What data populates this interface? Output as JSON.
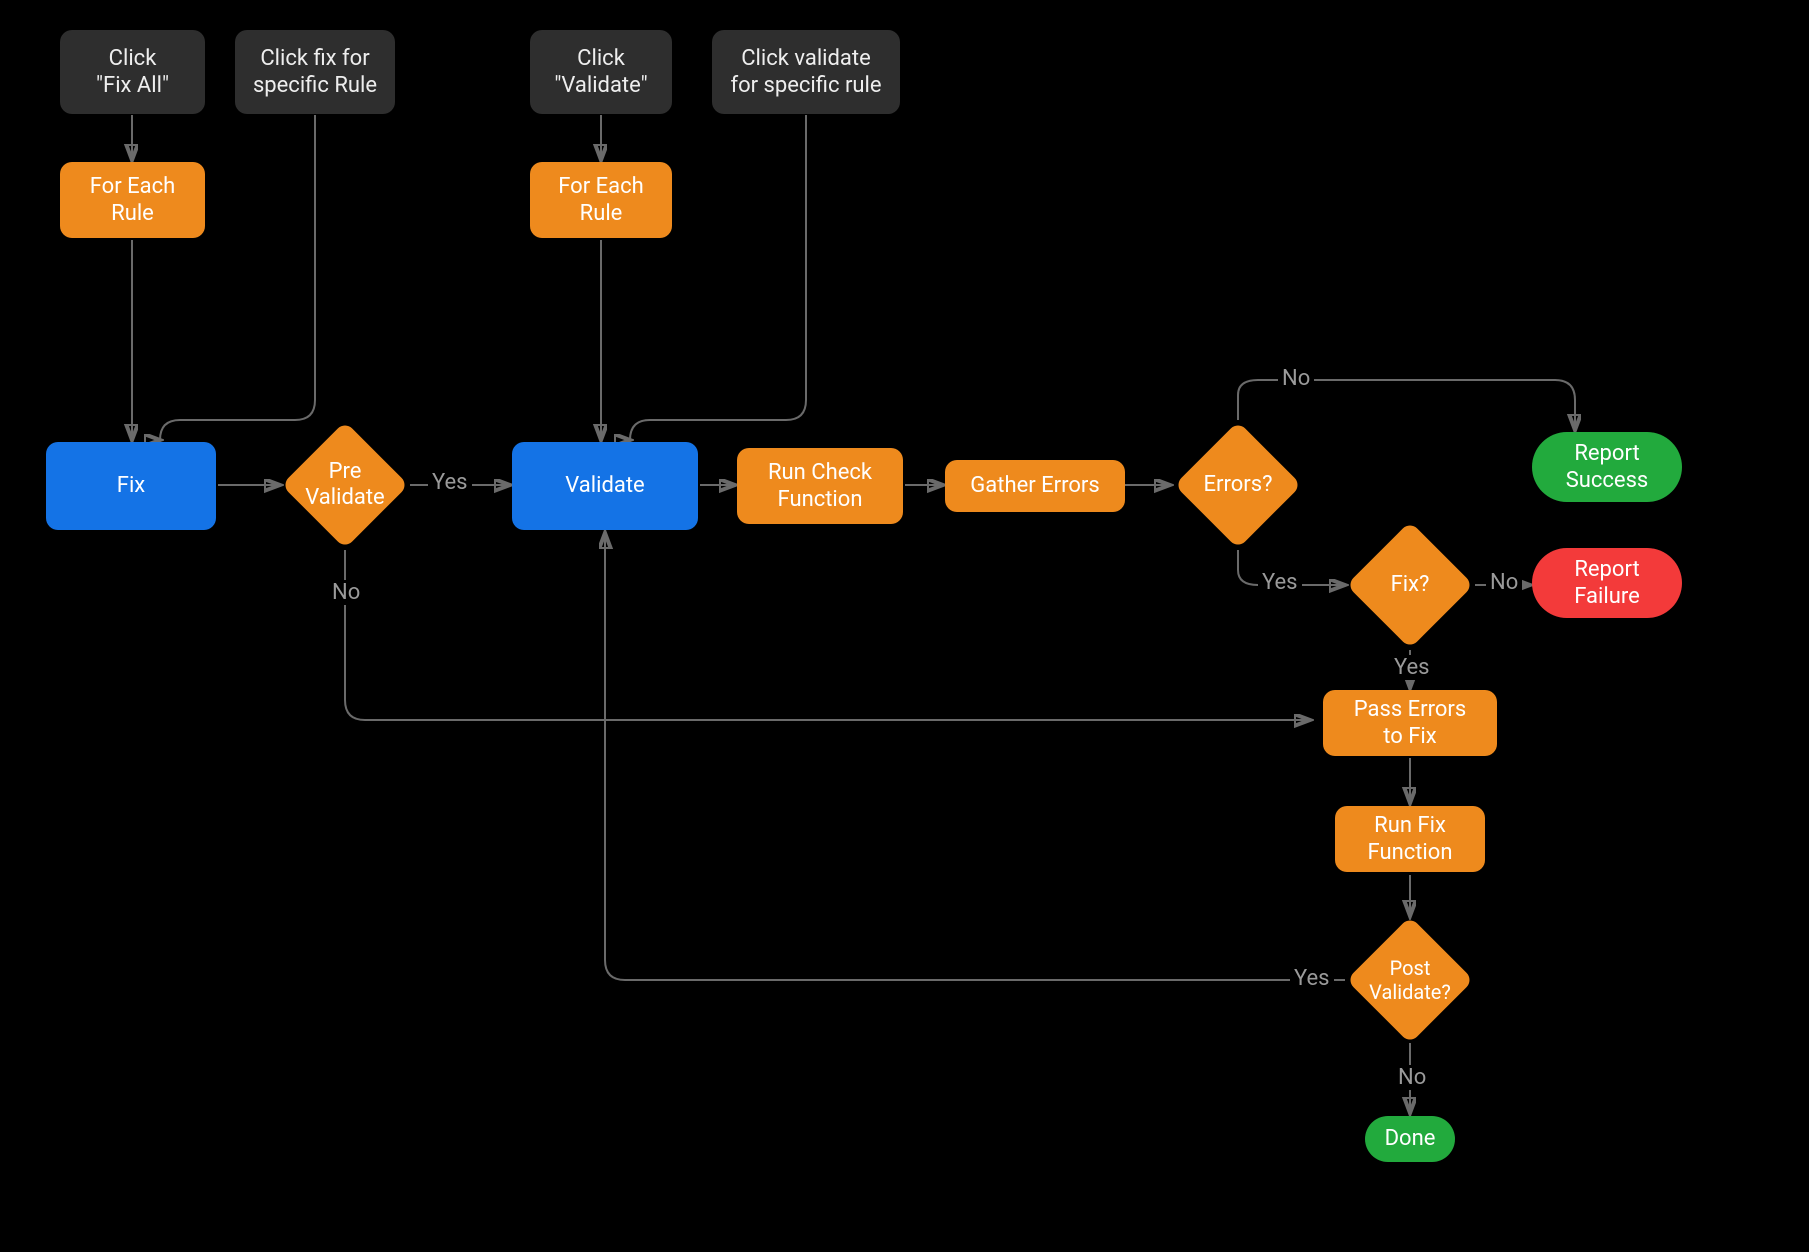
{
  "nodes": {
    "clickFixAll": "Click\n\"Fix All\"",
    "clickFixSpecific": "Click fix for\nspecific Rule",
    "clickValidate": "Click\n\"Validate\"",
    "clickValidateSpecific": "Click validate\nfor specific rule",
    "forEachRule1": "For Each\nRule",
    "forEachRule2": "For Each\nRule",
    "fix": "Fix",
    "preValidate": "Pre\nValidate",
    "validate": "Validate",
    "runCheck": "Run Check\nFunction",
    "gatherErrors": "Gather Errors",
    "errors": "Errors?",
    "fixQ": "Fix?",
    "reportSuccess": "Report\nSuccess",
    "reportFailure": "Report\nFailure",
    "passErrors": "Pass Errors\nto Fix",
    "runFix": "Run Fix\nFunction",
    "postValidate": "Post\nValidate?",
    "done": "Done"
  },
  "edgeLabels": {
    "yes": "Yes",
    "no": "No"
  },
  "colors": {
    "gray": "#2e2e2e",
    "orange": "#ee8a1d",
    "blue": "#1473e6",
    "green": "#22aa3d",
    "red": "#f33a3a",
    "edge": "#6a6a6a",
    "label": "#9a9a9a",
    "bg": "#000000"
  }
}
